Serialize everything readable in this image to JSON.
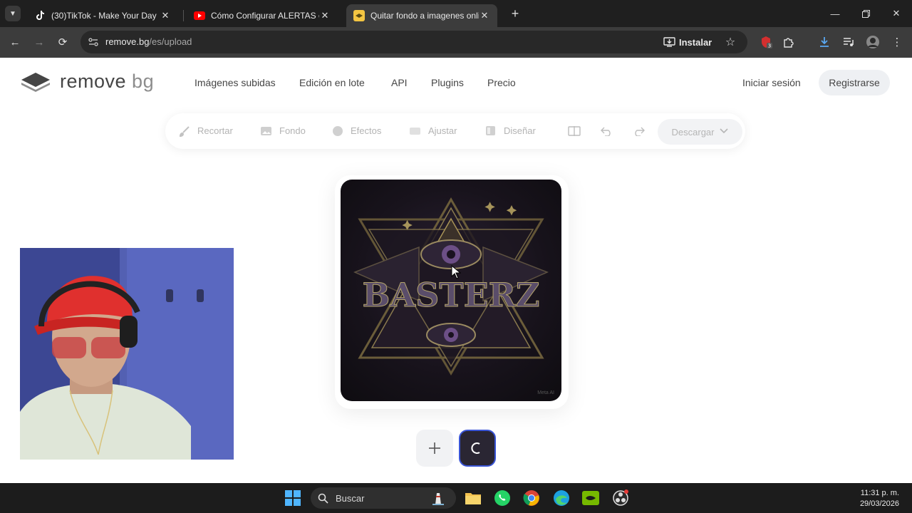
{
  "browser": {
    "tabs": [
      {
        "title": "(30)TikTok - Make Your Day",
        "favicon": "tiktok-icon",
        "active": false
      },
      {
        "title": "Cómo Configurar ALERTAS en K",
        "favicon": "youtube-icon",
        "active": false
      },
      {
        "title": "Quitar fondo a imagenes online",
        "favicon": "removebg-favicon-icon",
        "active": true
      }
    ],
    "url_domain": "remove.bg",
    "url_path": "/es/upload",
    "install_label": "Instalar",
    "extension_badge": "3"
  },
  "site": {
    "logo_word1": "remove",
    "logo_word2": "bg",
    "nav": [
      "Imágenes subidas",
      "Edición en lote",
      "API",
      "Plugins",
      "Precio"
    ],
    "login": "Iniciar sesión",
    "signup": "Registrarse"
  },
  "editor": {
    "tools": [
      "Recortar",
      "Fondo",
      "Efectos",
      "Ajustar",
      "Diseñar"
    ],
    "download": "Descargar",
    "image_text": "BASTERZ",
    "image_watermark": "Meta AI"
  },
  "taskbar": {
    "search_placeholder": "Buscar",
    "time": "11:31 p. m.",
    "date": "29/03/2026"
  },
  "colors": {
    "accent_blue": "#3a55d6",
    "chrome_dark": "#1f1f1f",
    "toolbar": "#3c3c3c",
    "text_dark": "#454545"
  }
}
